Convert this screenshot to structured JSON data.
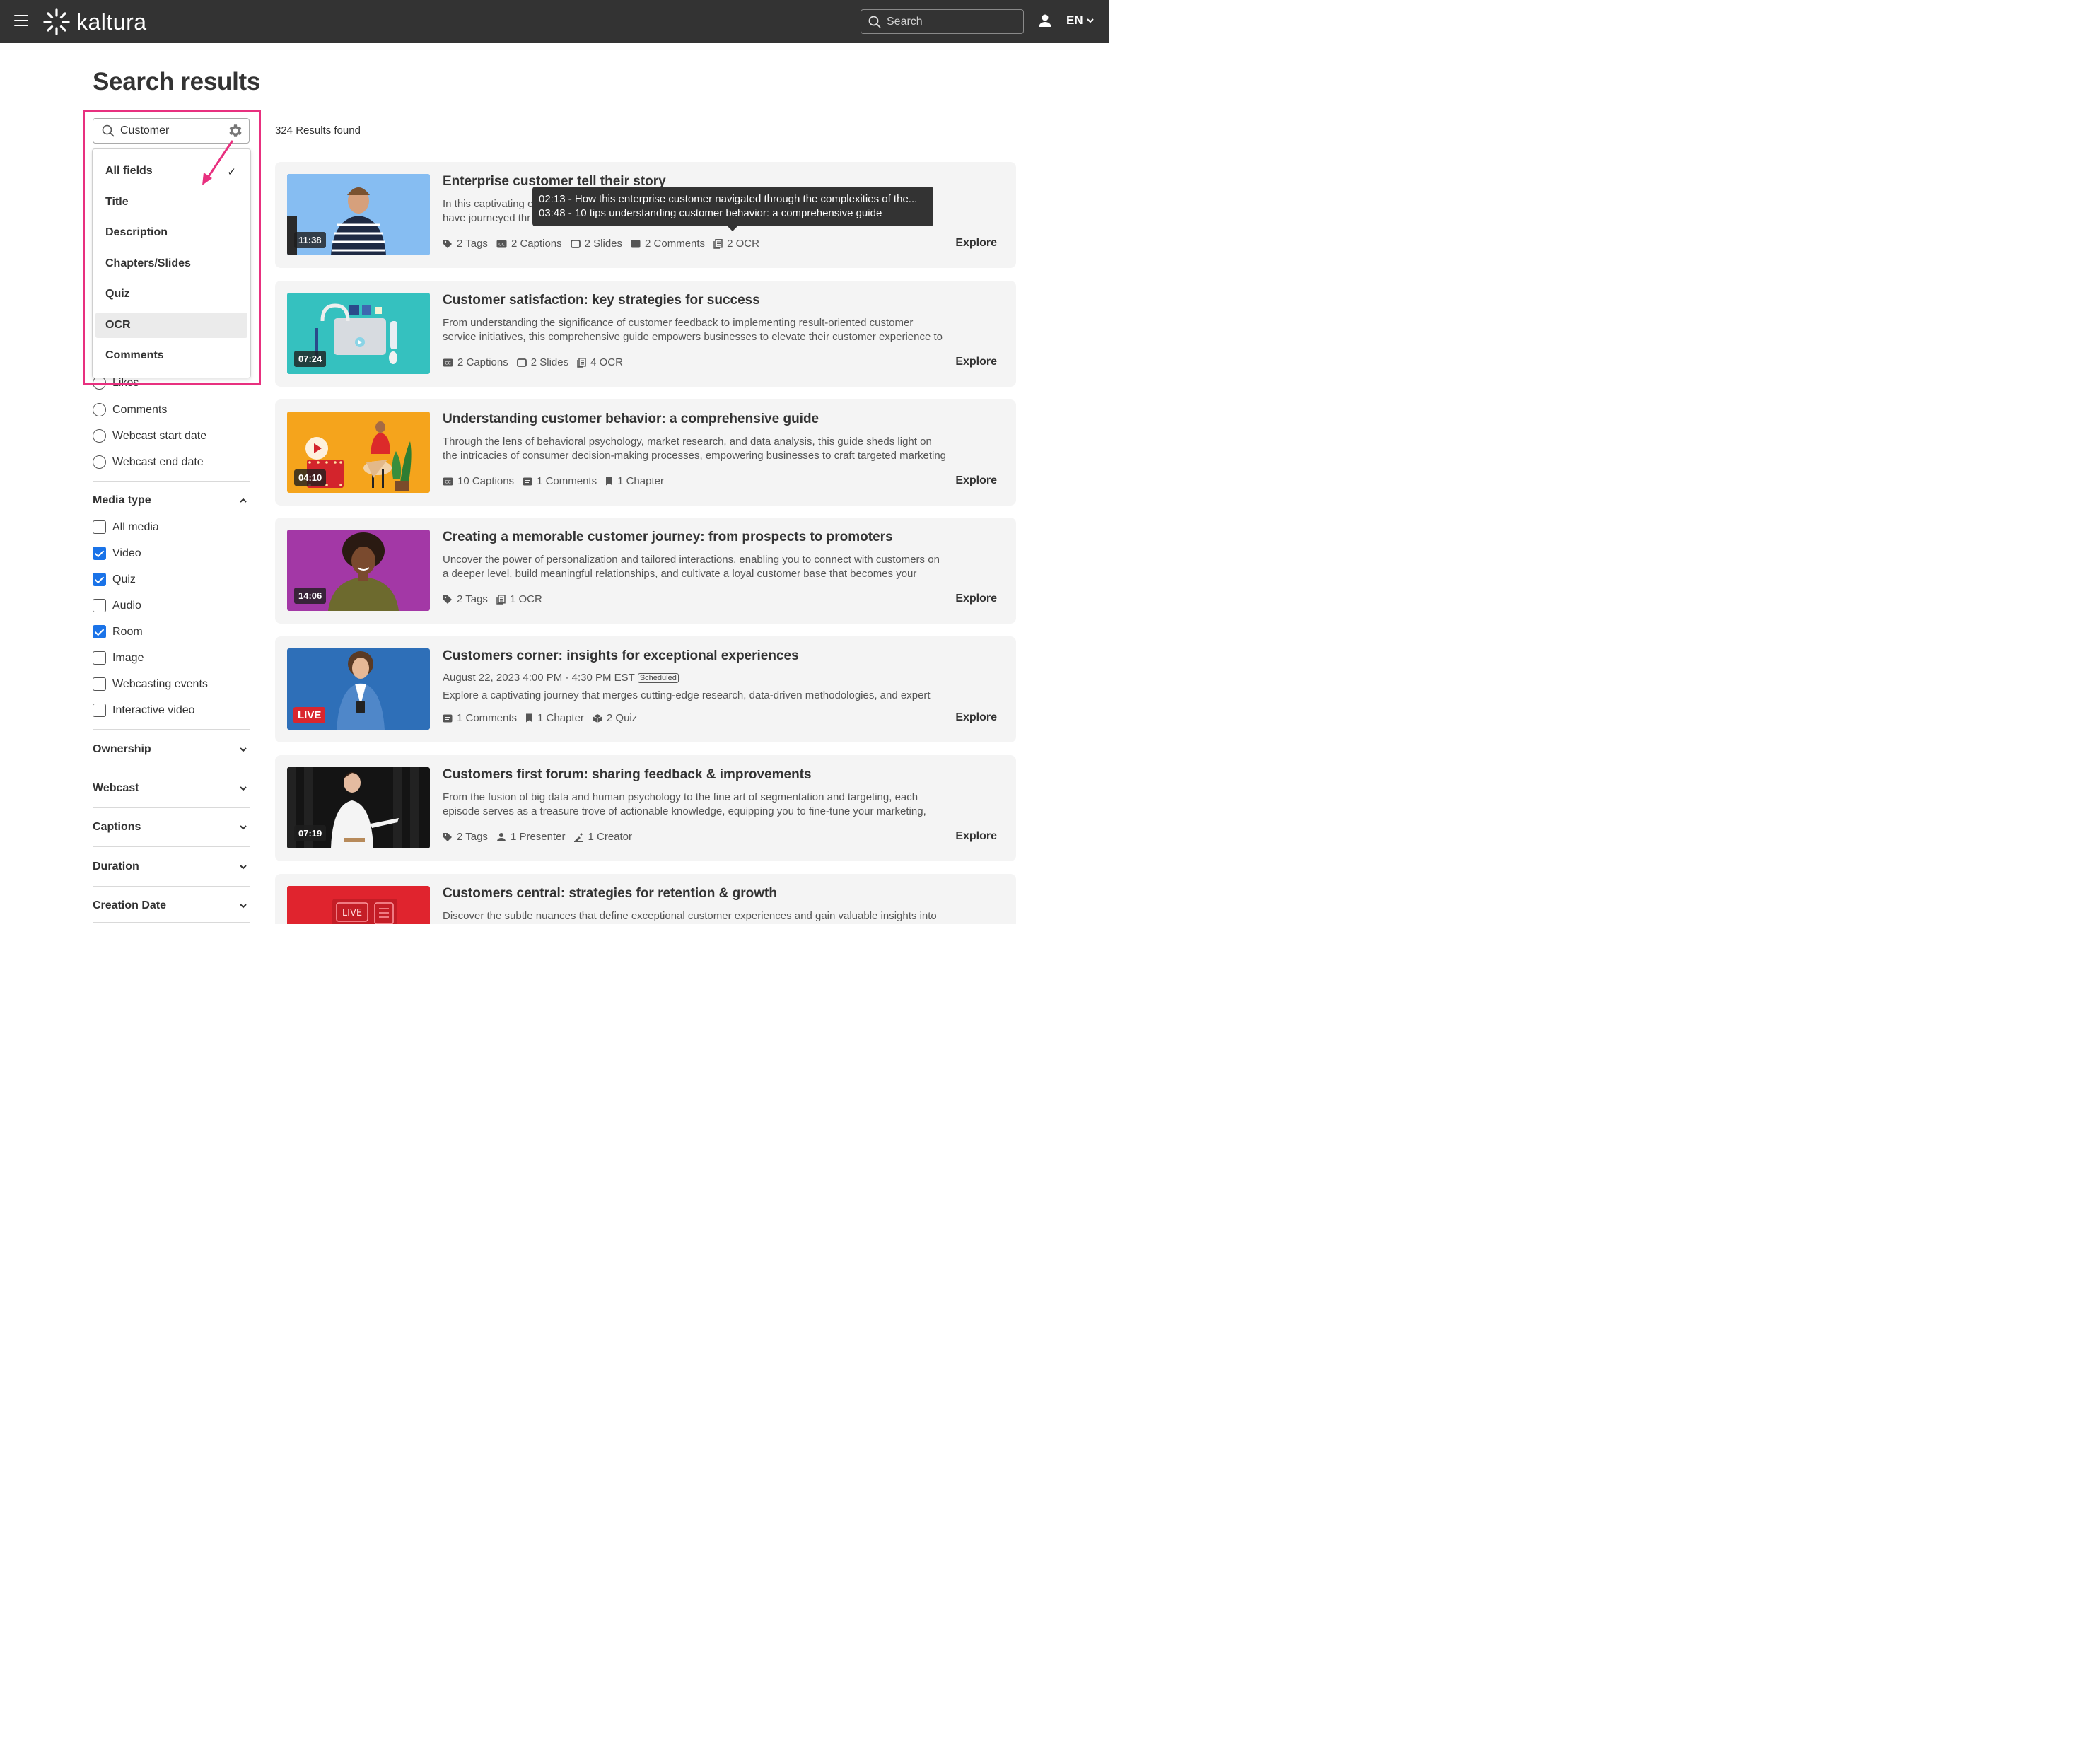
{
  "header": {
    "logo": "kaltura",
    "search_placeholder": "Search",
    "language": "EN"
  },
  "page": {
    "title": "Search results",
    "results_count": "324 Results found"
  },
  "search_box": {
    "value": "Customer",
    "fields": [
      {
        "label": "All fields",
        "checked": true
      },
      {
        "label": "Title"
      },
      {
        "label": "Description"
      },
      {
        "label": "Chapters/Slides"
      },
      {
        "label": "Quiz"
      },
      {
        "label": "OCR",
        "hovered": true
      },
      {
        "label": "Comments"
      }
    ]
  },
  "sort_options": {
    "items": [
      "Likes",
      "Comments",
      "Webcast start date",
      "Webcast end date"
    ]
  },
  "filters": {
    "media_type": {
      "label": "Media type",
      "options": [
        {
          "label": "All media",
          "checked": false
        },
        {
          "label": "Video",
          "checked": true
        },
        {
          "label": "Quiz",
          "checked": true
        },
        {
          "label": "Audio",
          "checked": false
        },
        {
          "label": "Room",
          "checked": true
        },
        {
          "label": "Image",
          "checked": false
        },
        {
          "label": "Webcasting events",
          "checked": false
        },
        {
          "label": "Interactive video",
          "checked": false
        }
      ]
    },
    "collapsed_sections": [
      "Ownership",
      "Webcast",
      "Captions",
      "Duration",
      "Creation Date"
    ]
  },
  "tooltip": {
    "lines": [
      "02:13 - How this enterprise customer navigated through the complexities of the...",
      "03:48 - 10 tips understanding customer behavior: a comprehensive guide"
    ]
  },
  "results": [
    {
      "title": "Enterprise customer tell their story",
      "desc_fragments": [
        "In this captivating c",
        "have journeyed thr"
      ],
      "duration": "11:38",
      "meta": [
        "2 Tags",
        "2 Captions",
        "2 Slides",
        "2 Comments",
        "2 OCR"
      ],
      "explore": "Explore"
    },
    {
      "title": "Customer satisfaction: key strategies for success",
      "description": "From understanding the significance of customer feedback to implementing result-oriented customer service initiatives, this comprehensive guide empowers businesses to elevate their customer experience to",
      "duration": "07:24",
      "meta": [
        "2 Captions",
        "2 Slides",
        "4 OCR"
      ],
      "explore": "Explore"
    },
    {
      "title": "Understanding customer behavior: a comprehensive guide",
      "description": "Through the lens of behavioral psychology, market research, and data analysis, this guide sheds light on the intricacies of consumer decision-making processes, empowering businesses to craft targeted marketing",
      "duration": "04:10",
      "meta": [
        "10 Captions",
        "1 Comments",
        "1 Chapter"
      ],
      "explore": "Explore"
    },
    {
      "title": "Creating a memorable customer journey: from prospects to promoters",
      "description": "Uncover the power of personalization and tailored interactions, enabling you to connect with customers on a deeper level, build meaningful relationships, and cultivate a loyal customer base that becomes your",
      "duration": "14:06",
      "meta": [
        "2 Tags",
        "1 OCR"
      ],
      "explore": "Explore"
    },
    {
      "title": "Customers corner: insights for exceptional experiences",
      "date": "August 22, 2023 4:00 PM - 4:30 PM EST",
      "badge": "Scheduled",
      "description": "Explore a captivating journey that merges cutting-edge research, data-driven methodologies, and expert",
      "live": "LIVE",
      "meta": [
        "1 Comments",
        "1 Chapter",
        "2 Quiz"
      ],
      "explore": "Explore"
    },
    {
      "title": "Customers first forum: sharing feedback & improvements",
      "description": "From the fusion of big data and human psychology to the fine art of segmentation and targeting, each episode serves as a treasure trove of actionable knowledge, equipping you to fine-tune your marketing,",
      "duration": "07:19",
      "meta": [
        "2 Tags",
        "1 Presenter",
        "1 Creator"
      ],
      "explore": "Explore"
    },
    {
      "title": "Customers central: strategies for retention & growth",
      "description": "Discover the subtle nuances that define exceptional customer experiences and gain valuable insights into",
      "thumb_text": "LIVE"
    }
  ],
  "colors": {
    "topbar": "#333333",
    "highlight": "#e8307f",
    "checkbox": "#1a73e8",
    "live": "#d9262e"
  }
}
